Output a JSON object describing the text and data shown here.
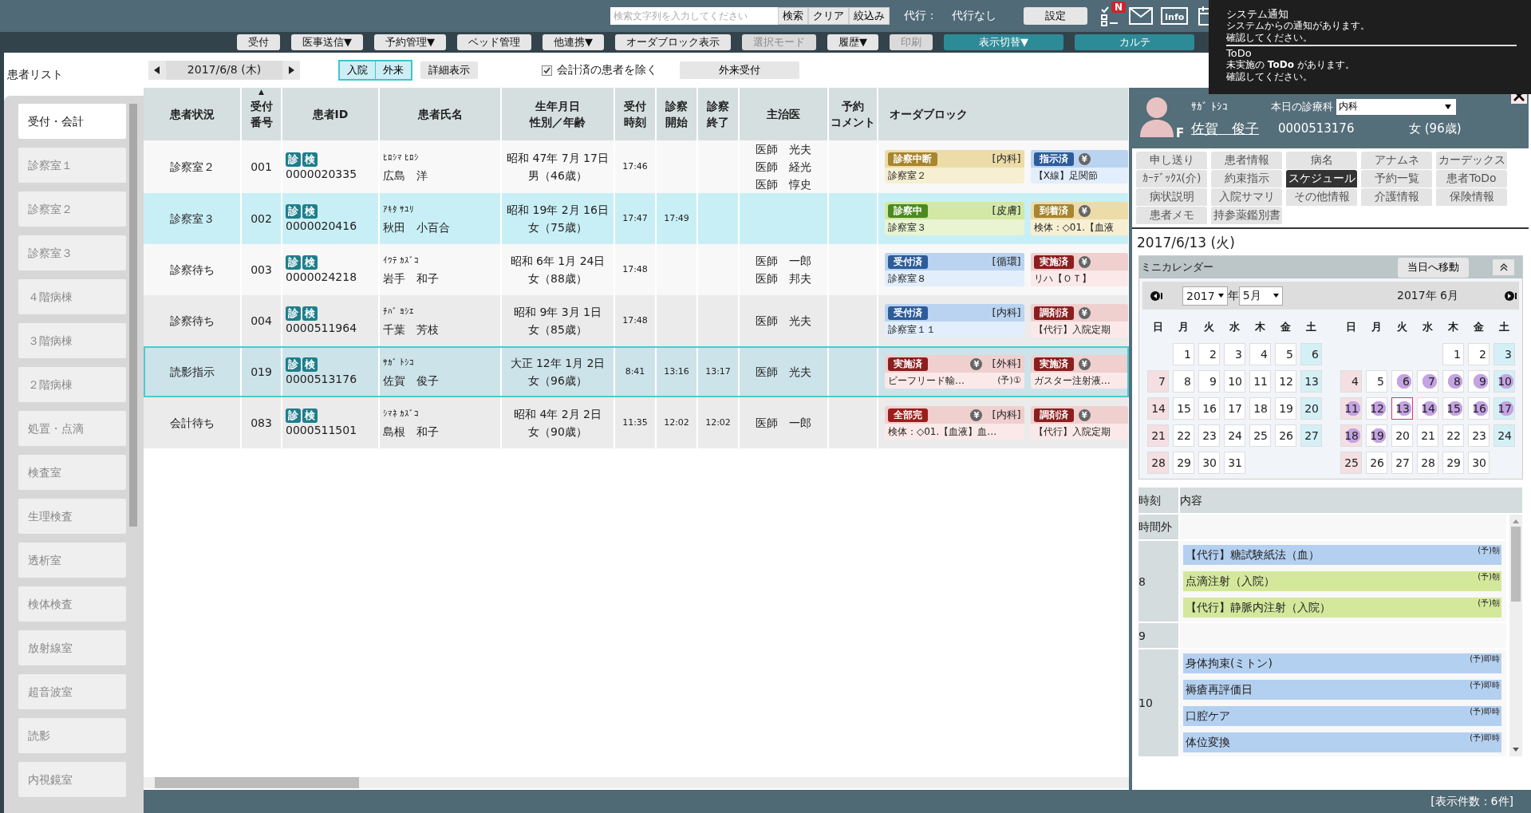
{
  "top_bar": {
    "search": {
      "placeholder": "検索文字列を入力してください"
    },
    "search_buttons": [
      "検索",
      "クリア",
      "絞込み"
    ],
    "proxy_label": "代行：",
    "proxy_value": "代行なし",
    "settings_button": "設定",
    "todo_badge": "N",
    "info_label": "Info"
  },
  "toolbar": [
    {
      "label": "受付",
      "kind": "plain",
      "disabled": false
    },
    {
      "label": "医事送信▼",
      "kind": "plain",
      "disabled": false
    },
    {
      "label": "予約管理▼",
      "kind": "plain",
      "disabled": false
    },
    {
      "label": "ベッド管理",
      "kind": "plain",
      "disabled": false
    },
    {
      "label": "他連携▼",
      "kind": "plain",
      "disabled": false
    },
    {
      "label": "オーダブロック表示",
      "kind": "plain",
      "disabled": false
    },
    {
      "label": "選択モード",
      "kind": "plain",
      "disabled": true
    },
    {
      "label": "履歴▼",
      "kind": "plain",
      "disabled": false
    },
    {
      "label": "印刷",
      "kind": "plain",
      "disabled": true
    },
    {
      "label": "表示切替▼",
      "kind": "accent",
      "disabled": false
    },
    {
      "label": "カルテ",
      "kind": "accent",
      "disabled": false
    }
  ],
  "notification": {
    "title": "システム通知",
    "lines": [
      "システムからの通知があります。",
      "確認してください。"
    ],
    "todo_title": "ToDo",
    "todo_lines": [
      "未実施の **ToDo** があります。",
      "確認してください。"
    ]
  },
  "sidebar": {
    "title": "患者リスト",
    "items": [
      {
        "label": "受付・会計",
        "selected": true
      },
      {
        "label": "診察室１",
        "selected": false
      },
      {
        "label": "診察室２",
        "selected": false
      },
      {
        "label": "診察室３",
        "selected": false
      },
      {
        "label": "４階病棟",
        "selected": false
      },
      {
        "label": "３階病棟",
        "selected": false
      },
      {
        "label": "２階病棟",
        "selected": false
      },
      {
        "label": "処置・点滴",
        "selected": false
      },
      {
        "label": "検査室",
        "selected": false
      },
      {
        "label": "生理検査",
        "selected": false
      },
      {
        "label": "透析室",
        "selected": false
      },
      {
        "label": "検体検査",
        "selected": false
      },
      {
        "label": "放射線室",
        "selected": false
      },
      {
        "label": "超音波室",
        "selected": false
      },
      {
        "label": "読影",
        "selected": false
      },
      {
        "label": "内視鏡室",
        "selected": false
      }
    ]
  },
  "filters": {
    "date": "2017/6/8 (木)",
    "view_toggle": [
      {
        "label": "入院",
        "selected": true
      },
      {
        "label": "外来",
        "selected": true
      }
    ],
    "detail_button": "詳細表示",
    "exclude_paid": {
      "label": "会計済の患者を除く",
      "checked": true
    },
    "outpatient_button": "外来受付"
  },
  "table": {
    "columns": [
      {
        "lines": [
          "患者状況"
        ]
      },
      {
        "lines": [
          "受付",
          "番号"
        ],
        "sort_mark": "▲"
      },
      {
        "lines": [
          "患者ID"
        ]
      },
      {
        "lines": [
          "患者氏名"
        ]
      },
      {
        "lines": [
          "生年月日",
          "性別／年齢"
        ]
      },
      {
        "lines": [
          "受付",
          "時刻"
        ]
      },
      {
        "lines": [
          "診察",
          "開始"
        ]
      },
      {
        "lines": [
          "診察",
          "終了"
        ]
      },
      {
        "lines": [
          "主治医"
        ]
      },
      {
        "lines": [
          "予約",
          "コメント"
        ]
      },
      {
        "lines": [
          "オーダブロック"
        ]
      }
    ],
    "rows": [
      {
        "selected": false,
        "color": "#f8f8f8",
        "status": "診察室２",
        "number": "001",
        "badges": [
          "診",
          "検"
        ],
        "patient_id": "0000020335",
        "kana": "ﾋﾛｼﾏ ﾋﾛｼ",
        "name": "広島　洋",
        "birth": "昭和 47年 7月 17日",
        "sex_age": "男（46歳）",
        "reception_time": "17:46",
        "doctors": [
          "医師　光夫",
          "医師　経光",
          "医師　惇史"
        ],
        "orders": [
          {
            "kind": "interrupted",
            "label": "診察中断",
            "department": "[内科]",
            "text": "診察室２"
          },
          {
            "kind": "ordered",
            "label": "指示済",
            "yen_mark": "¥",
            "text": "【X線】足関節"
          }
        ]
      },
      {
        "selected": false,
        "color": "#c9eff6",
        "status": "診察室３",
        "number": "002",
        "badges": [
          "診",
          "検"
        ],
        "patient_id": "0000020416",
        "kana": "ｱｷﾀ ｻﾕﾘ",
        "name": "秋田　小百合",
        "birth": "昭和 19年 2月 16日",
        "sex_age": "女（75歳）",
        "reception_time": "17:47",
        "exam_start": "17:49",
        "orders": [
          {
            "kind": "in_exam",
            "label": "診察中",
            "department": "[皮膚]",
            "text": "診察室３"
          },
          {
            "kind": "arrived",
            "label": "到着済",
            "yen_mark": "¥",
            "text": "検体：◇01.【血液"
          }
        ]
      },
      {
        "selected": false,
        "color": "#f8f8f8",
        "status": "診察待ち",
        "number": "003",
        "badges": [
          "診",
          "検"
        ],
        "patient_id": "0000024218",
        "kana": "ｲﾜﾃ ｶｽﾞｺ",
        "name": "岩手　和子",
        "birth": "昭和 6年 1月 24日",
        "sex_age": "女（88歳）",
        "reception_time": "17:48",
        "doctors": [
          "医師　一郎",
          "医師　邦夫"
        ],
        "orders": [
          {
            "kind": "received",
            "label": "受付済",
            "department": "[循環]",
            "text": "診察室８"
          },
          {
            "kind": "done",
            "label": "実施済",
            "yen_mark": "¥",
            "text": "リハ【ＯＴ】"
          }
        ]
      },
      {
        "selected": false,
        "color": "#ebebeb",
        "status": "診察待ち",
        "number": "004",
        "badges": [
          "診",
          "検"
        ],
        "patient_id": "0000511964",
        "kana": "ﾁﾊﾞ ﾖｼｴ",
        "name": "千葉　芳枝",
        "birth": "昭和 9年 3月 1日",
        "sex_age": "女（85歳）",
        "reception_time": "17:48",
        "doctors": [
          "医師　光夫"
        ],
        "orders": [
          {
            "kind": "received",
            "label": "受付済",
            "department": "[内科]",
            "text": "診察室１１"
          },
          {
            "kind": "dispensed",
            "label": "調剤済",
            "yen_mark": "¥",
            "text": "【代行】入院定期"
          }
        ]
      },
      {
        "selected": true,
        "color": "#cde3ea",
        "status": "読影指示",
        "number": "019",
        "badges": [
          "診",
          "検"
        ],
        "patient_id": "0000513176",
        "kana": "ｻｶﾞ ﾄｼｺ",
        "name": "佐賀　俊子",
        "birth": "大正 12年 1月 2日",
        "sex_age": "女（96歳）",
        "reception_time": "8:41",
        "exam_start": "13:16",
        "exam_end": "13:17",
        "doctors": [
          "医師　光夫"
        ],
        "orders": [
          {
            "kind": "done",
            "label": "実施済",
            "yen_mark": "¥",
            "department": "[外科]",
            "text": "ビーフリード輸…",
            "note": "(予)①"
          },
          {
            "kind": "done",
            "label": "実施済",
            "yen_mark": "¥",
            "text": "ガスター注射液…"
          }
        ]
      },
      {
        "selected": false,
        "color": "#ebebeb",
        "status": "会計待ち",
        "number": "083",
        "badges": [
          "診",
          "検"
        ],
        "patient_id": "0000511501",
        "kana": "ｼﾏﾈ ｶｽﾞｺ",
        "name": "島根　和子",
        "birth": "昭和 4年 2月 2日",
        "sex_age": "女（90歳）",
        "reception_time": "11:35",
        "exam_start": "12:02",
        "exam_end": "12:02",
        "doctors": [
          "医師　一郎"
        ],
        "orders": [
          {
            "kind": "complete",
            "label": "全部完",
            "yen_mark": "¥",
            "department": "[内科]",
            "text": "検体：◇01.【血液】血…"
          },
          {
            "kind": "dispensed",
            "label": "調剤済",
            "yen_mark": "¥",
            "text": "【代行】入院定期"
          }
        ]
      }
    ]
  },
  "patient_panel": {
    "kana": "ｻｶﾞ ﾄｼｺ",
    "avatar_letter": "F",
    "dept_label": "本日の診療科",
    "dept_select": "内科",
    "name": "佐賀　俊子",
    "patient_id": "0000513176",
    "sex_age": "女 (96歳)",
    "tabs": [
      {
        "label": "申し送り",
        "selected": false
      },
      {
        "label": "患者情報",
        "selected": false
      },
      {
        "label": "病名",
        "selected": false
      },
      {
        "label": "アナムネ",
        "selected": false
      },
      {
        "label": "カーデックス",
        "selected": false
      },
      {
        "label": "ｶｰﾃﾞｯｸｽ(介)",
        "selected": false
      },
      {
        "label": "約束指示",
        "selected": false
      },
      {
        "label": "スケジュール",
        "selected": true
      },
      {
        "label": "予約一覧",
        "selected": false
      },
      {
        "label": "患者ToDo",
        "selected": false
      },
      {
        "label": "病状説明",
        "selected": false
      },
      {
        "label": "入院サマリ",
        "selected": false
      },
      {
        "label": "その他情報",
        "selected": false
      },
      {
        "label": "介護情報",
        "selected": false
      },
      {
        "label": "保険情報",
        "selected": false
      },
      {
        "label": "患者メモ",
        "selected": false
      },
      {
        "label": "持参薬鑑別書",
        "selected": false
      }
    ],
    "date": "2017/6/13 (火)"
  },
  "mini_calendar": {
    "title": "ミニカレンダー",
    "today_button": "当日へ移動",
    "year": "2017",
    "year_unit": "年",
    "month": "5月",
    "next_title": "2017年 6月",
    "months": [
      {
        "weekdays": [
          "日",
          "月",
          "火",
          "水",
          "木",
          "金",
          "土"
        ],
        "weeks": [
          [
            {
              "day": "1",
              "event": false,
              "today": false
            },
            {
              "day": "2",
              "event": false,
              "today": false
            },
            {
              "day": "3",
              "event": false,
              "today": false
            },
            {
              "day": "4",
              "event": false,
              "today": false
            },
            {
              "day": "5",
              "event": false,
              "today": false
            },
            {
              "day": "6",
              "event": false,
              "today": false
            }
          ],
          [
            {
              "day": "7",
              "event": false,
              "today": false
            },
            {
              "day": "8",
              "event": false,
              "today": false
            },
            {
              "day": "9",
              "event": false,
              "today": false
            },
            {
              "day": "10",
              "event": false,
              "today": false
            },
            {
              "day": "11",
              "event": false,
              "today": false
            },
            {
              "day": "12",
              "event": false,
              "today": false
            },
            {
              "day": "13",
              "event": false,
              "today": false
            }
          ],
          [
            {
              "day": "14",
              "event": false,
              "today": false
            },
            {
              "day": "15",
              "event": false,
              "today": false
            },
            {
              "day": "16",
              "event": false,
              "today": false
            },
            {
              "day": "17",
              "event": false,
              "today": false
            },
            {
              "day": "18",
              "event": false,
              "today": false
            },
            {
              "day": "19",
              "event": false,
              "today": false
            },
            {
              "day": "20",
              "event": false,
              "today": false
            }
          ],
          [
            {
              "day": "21",
              "event": false,
              "today": false
            },
            {
              "day": "22",
              "event": false,
              "today": false
            },
            {
              "day": "23",
              "event": false,
              "today": false
            },
            {
              "day": "24",
              "event": false,
              "today": false
            },
            {
              "day": "25",
              "event": false,
              "today": false
            },
            {
              "day": "26",
              "event": false,
              "today": false
            },
            {
              "day": "27",
              "event": false,
              "today": false
            }
          ],
          [
            {
              "day": "28",
              "event": false,
              "today": false
            },
            {
              "day": "29",
              "event": false,
              "today": false
            },
            {
              "day": "30",
              "event": false,
              "today": false
            },
            {
              "day": "31",
              "event": false,
              "today": false
            }
          ]
        ]
      },
      {
        "weekdays": [
          "日",
          "月",
          "火",
          "水",
          "木",
          "金",
          "土"
        ],
        "weeks": [
          [
            {
              "day": "1",
              "event": false,
              "today": false
            },
            {
              "day": "2",
              "event": false,
              "today": false
            },
            {
              "day": "3",
              "event": false,
              "today": false
            }
          ],
          [
            {
              "day": "4",
              "event": false,
              "today": false
            },
            {
              "day": "5",
              "event": false,
              "today": false
            },
            {
              "day": "6",
              "event": true,
              "today": false
            },
            {
              "day": "7",
              "event": true,
              "today": false
            },
            {
              "day": "8",
              "event": true,
              "today": false
            },
            {
              "day": "9",
              "event": true,
              "today": false
            },
            {
              "day": "10",
              "event": true,
              "today": false
            }
          ],
          [
            {
              "day": "11",
              "event": true,
              "today": false
            },
            {
              "day": "12",
              "event": true,
              "today": false
            },
            {
              "day": "13",
              "event": true,
              "today": true
            },
            {
              "day": "14",
              "event": true,
              "today": false
            },
            {
              "day": "15",
              "event": true,
              "today": false
            },
            {
              "day": "16",
              "event": true,
              "today": false
            },
            {
              "day": "17",
              "event": true,
              "today": false
            }
          ],
          [
            {
              "day": "18",
              "event": true,
              "today": false
            },
            {
              "day": "19",
              "event": true,
              "today": false
            },
            {
              "day": "20",
              "event": false,
              "today": false
            },
            {
              "day": "21",
              "event": false,
              "today": false
            },
            {
              "day": "22",
              "event": false,
              "today": false
            },
            {
              "day": "23",
              "event": false,
              "today": false
            },
            {
              "day": "24",
              "event": false,
              "today": false
            }
          ],
          [
            {
              "day": "25",
              "event": false,
              "today": false
            },
            {
              "day": "26",
              "event": false,
              "today": false
            },
            {
              "day": "27",
              "event": false,
              "today": false
            },
            {
              "day": "28",
              "event": false,
              "today": false
            },
            {
              "day": "29",
              "event": false,
              "today": false
            },
            {
              "day": "30",
              "event": false,
              "today": false
            }
          ]
        ]
      }
    ]
  },
  "schedule": {
    "columns": [
      "時刻",
      "内容"
    ],
    "slots": [
      {
        "time": "時間外"
      },
      {
        "time": "8",
        "items": [
          {
            "text": "【代行】糖試験紙法（血）",
            "tag": "(予)朝",
            "color": "#b4d0f0"
          },
          {
            "text": "点滴注射（入院）",
            "tag": "(予)朝",
            "color": "#d4e89c"
          },
          {
            "text": "【代行】静脈内注射（入院）",
            "tag": "(予)朝",
            "color": "#d4e89c"
          }
        ]
      },
      {
        "time": "9"
      },
      {
        "time": "10",
        "items": [
          {
            "text": "身体拘束(ミトン)",
            "tag": "(予)即時",
            "color": "#b4d0f0"
          },
          {
            "text": "褥瘡再評価日",
            "tag": "(予)即時",
            "color": "#b4d0f0"
          },
          {
            "text": "口腔ケア",
            "tag": "(予)即時",
            "color": "#b4d0f0"
          },
          {
            "text": "体位変換",
            "tag": "(予)即時",
            "color": "#b4d0f0"
          }
        ]
      }
    ]
  },
  "status_bar": {
    "count": "[表示件数：6件]"
  }
}
